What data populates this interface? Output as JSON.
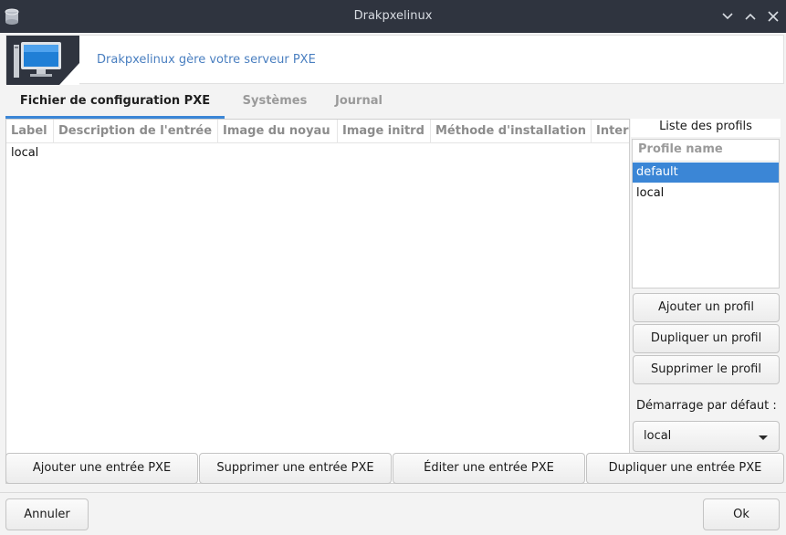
{
  "window": {
    "title": "Drakpxelinux"
  },
  "header": {
    "subtitle": "Drakpxelinux gère votre serveur PXE"
  },
  "tabs": [
    {
      "label": "Fichier de configuration PXE",
      "active": true
    },
    {
      "label": "Systèmes",
      "active": false
    },
    {
      "label": "Journal",
      "active": false
    }
  ],
  "entries_table": {
    "columns": [
      "Label",
      "Description de l'entrée",
      "Image du noyau",
      "Image initrd",
      "Méthode d'installation",
      "Inter"
    ],
    "rows": [
      [
        "local"
      ]
    ]
  },
  "profiles": {
    "label": "Liste des profils",
    "column_header": "Profile name",
    "items": [
      {
        "name": "default",
        "selected": true
      },
      {
        "name": "local",
        "selected": false
      }
    ],
    "buttons": {
      "add": "Ajouter un profil",
      "duplicate": "Dupliquer un profil",
      "delete": "Supprimer le profil"
    },
    "default_boot_label": "Démarrage par défaut :",
    "default_boot_value": "local"
  },
  "entry_buttons": {
    "add": "Ajouter une entrée PXE",
    "delete": "Supprimer une entrée PXE",
    "edit": "Éditer une entrée PXE",
    "duplicate": "Dupliquer une entrée PXE"
  },
  "footer": {
    "cancel": "Annuler",
    "ok": "Ok"
  },
  "colors": {
    "accent": "#3b86d6",
    "titlebar": "#2f343f",
    "subtitle": "#4a7fc0"
  }
}
